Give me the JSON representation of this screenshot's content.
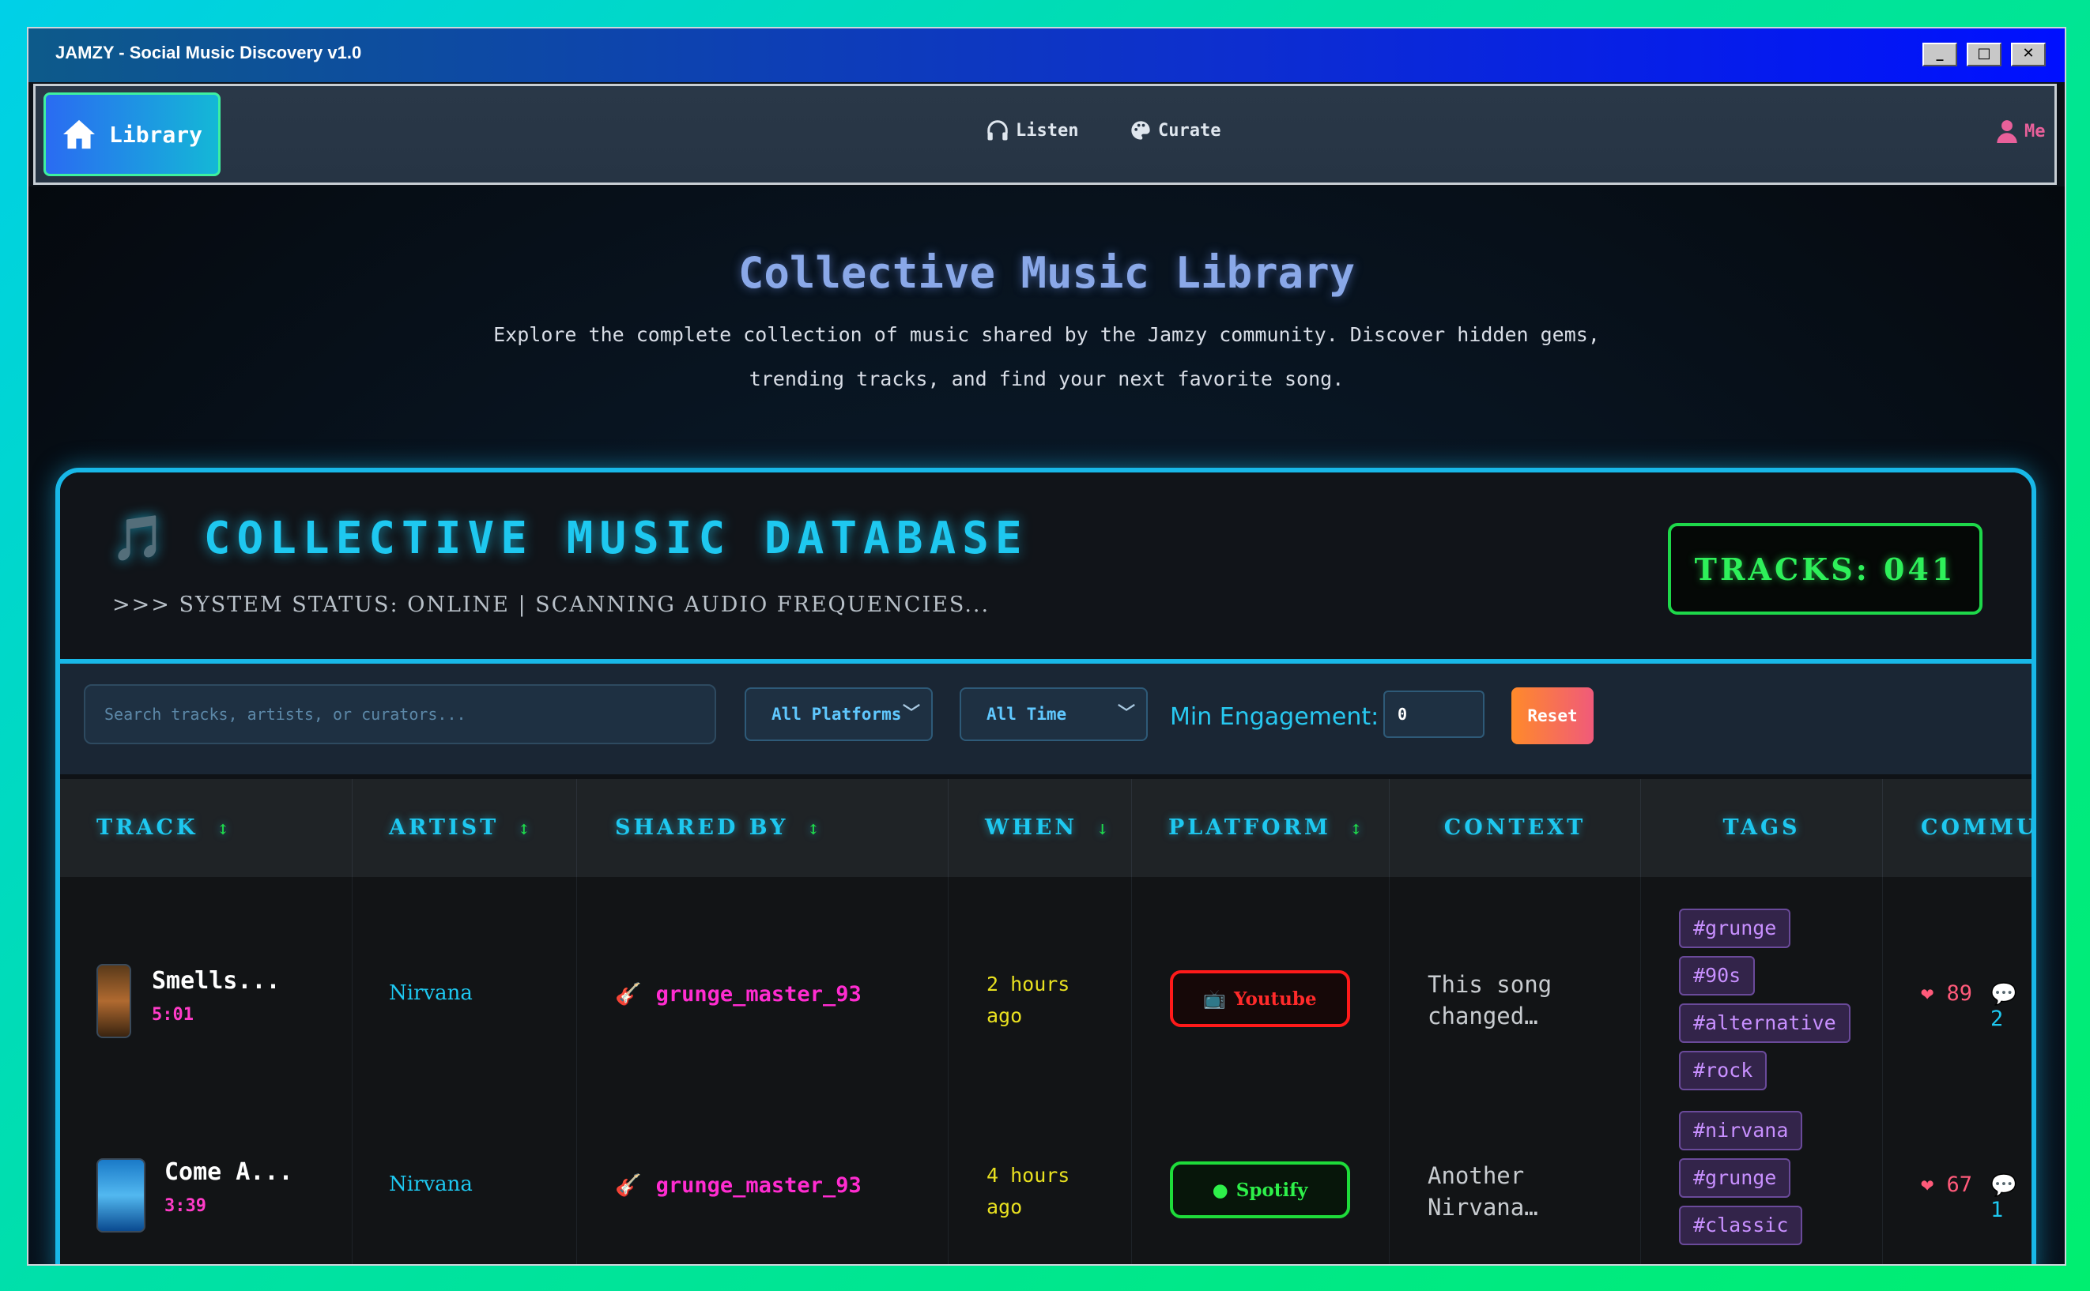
{
  "window": {
    "title": "JAMZY - Social Music Discovery v1.0",
    "minimize": "_",
    "maximize": "□",
    "close": "✕"
  },
  "nav": {
    "home_label": "Library",
    "listen_label": "Listen",
    "curate_label": "Curate",
    "me_label": "Me"
  },
  "hero": {
    "title": "Collective Music Library",
    "desc_line1": "Explore the complete collection of music shared by the Jamzy community. Discover hidden gems,",
    "desc_line2": "trending tracks, and find your next favorite song."
  },
  "database": {
    "icon": "🎵",
    "title": "COLLECTIVE MUSIC DATABASE",
    "status": ">>> SYSTEM STATUS: ONLINE | SCANNING AUDIO FREQUENCIES...",
    "tracks_count": "TRACKS: 041"
  },
  "filters": {
    "search_placeholder": "Search tracks, artists, or curators...",
    "platform": "All Platforms",
    "time": "All Time",
    "engagement_label": "Min Engagement:",
    "engagement_value": "0",
    "reset_label": "Reset"
  },
  "table": {
    "headers": {
      "track": "TRACK",
      "artist": "ARTIST",
      "shared_by": "SHARED BY",
      "when": "WHEN",
      "platform": "PLATFORM",
      "context": "CONTEXT",
      "tags": "TAGS",
      "community": "COMMUNI"
    },
    "sort_icons": {
      "neutral": "↕",
      "desc": "↓"
    },
    "rows": [
      {
        "title": "Smells...",
        "duration": "5:01",
        "artist": "Nirvana",
        "curator_icon": "🎸",
        "curator": "grunge_master_93",
        "when_line1": "2 hours",
        "when_line2": "ago",
        "platform_icon": "📺",
        "platform": "Youtube",
        "context_line1": "This song",
        "context_line2": "changed…",
        "tags": [
          "#grunge",
          "#90s",
          "#alternative",
          "#rock"
        ],
        "likes": "❤ 89",
        "comments": "💬 2"
      },
      {
        "title": "Come A...",
        "duration": "3:39",
        "artist": "Nirvana",
        "curator_icon": "🎸",
        "curator": "grunge_master_93",
        "when_line1": "4 hours",
        "when_line2": "ago",
        "platform_icon": "●",
        "platform": "Spotify",
        "context_line1": "Another",
        "context_line2": "Nirvana…",
        "tags": [
          "#nirvana",
          "#grunge",
          "#classic"
        ],
        "likes": "❤ 67",
        "comments": "💬 1"
      }
    ]
  }
}
